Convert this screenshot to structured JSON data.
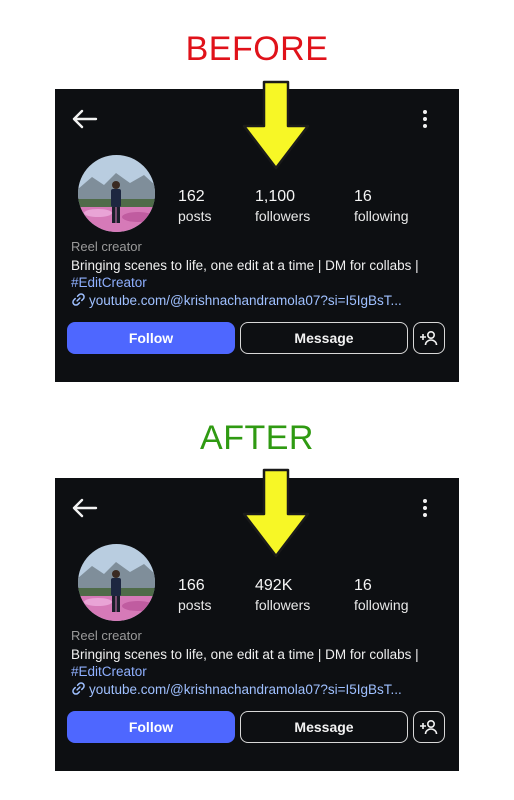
{
  "headings": {
    "before": "BEFORE",
    "after": "AFTER"
  },
  "colors": {
    "before_heading": "#e0121a",
    "after_heading": "#2f9a12",
    "arrow": "#f7f726",
    "follow_button": "#4e67ff",
    "panel_bg": "#0d0f12"
  },
  "before": {
    "posts_count": "162",
    "posts_label": "posts",
    "followers_count": "1,100",
    "followers_label": "followers",
    "following_count": "16",
    "following_label": "following",
    "category": "Reel creator",
    "bio_line": "Bringing scenes to life, one edit at a time | DM for collabs | ",
    "bio_hashtag": "#EditCreator",
    "link": "youtube.com/@krishnachandramola07?si=I5IgBsT...",
    "follow_label": "Follow",
    "message_label": "Message"
  },
  "after": {
    "posts_count": "166",
    "posts_label": "posts",
    "followers_count": "492K",
    "followers_label": "followers",
    "following_count": "16",
    "following_label": "following",
    "category": "Reel creator",
    "bio_line": "Bringing scenes to life, one edit at a time | DM for collabs | ",
    "bio_hashtag": "#EditCreator",
    "link": "youtube.com/@krishnachandramola07?si=I5IgBsT...",
    "follow_label": "Follow",
    "message_label": "Message"
  },
  "icons": [
    "back-arrow-icon",
    "more-vertical-icon",
    "link-icon",
    "add-person-icon",
    "pointer-arrow-icon"
  ]
}
